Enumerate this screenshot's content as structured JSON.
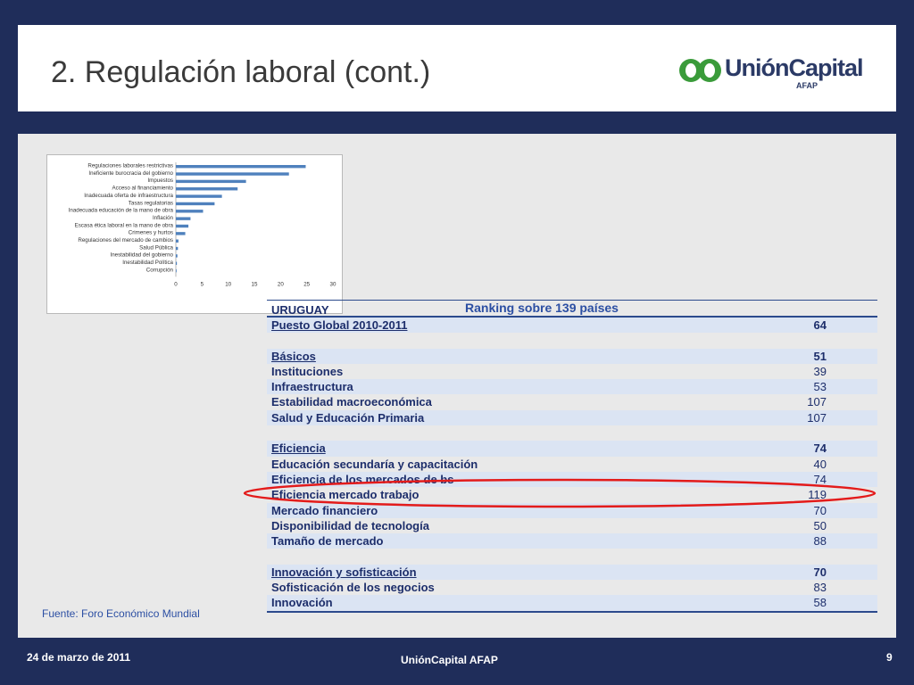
{
  "header": {
    "title": "2. Regulación laboral (cont.)",
    "logo_text": "UniónCapital",
    "logo_sub": "AFAP"
  },
  "chart_data": {
    "type": "bar",
    "orientation": "horizontal",
    "categories": [
      "Regulaciones laborales restrictivas",
      "Ineficiente burocracia del gobierno",
      "Impuestos",
      "Acceso al financiamiento",
      "Inadecuada oferta de infraestructura",
      "Tasas regulatorias",
      "Inadecuada educación de la mano de obra",
      "Inflación",
      "Escasa ética laboral en la mano de obra",
      "Crimenes y hurtos",
      "Regulaciones del mercado de cambios",
      "Salud Pública",
      "Inestabilidad del gobierno",
      "Inestabilidad Política",
      "Corrupción"
    ],
    "values": [
      24.8,
      21.6,
      13.4,
      11.8,
      8.8,
      7.4,
      5.2,
      2.8,
      2.4,
      1.8,
      0.5,
      0.4,
      0.3,
      0.2,
      0.1
    ],
    "xlim": [
      0,
      30
    ],
    "xticks": [
      "0",
      "5",
      "10",
      "15",
      "20",
      "25",
      "30"
    ],
    "grid": false,
    "bar_color": "#4f81bd"
  },
  "table": {
    "country": "URUGUAY",
    "heading": "Ranking sobre 139 países",
    "rows": [
      {
        "label": "Puesto Global 2010-2011",
        "value": "64",
        "type": "section",
        "alt": true
      },
      {
        "label": "",
        "value": "",
        "type": "blank",
        "alt": false
      },
      {
        "label": "Básicos",
        "value": "51",
        "type": "section",
        "alt": true
      },
      {
        "label": "Instituciones",
        "value": "39",
        "type": "item",
        "alt": false
      },
      {
        "label": "Infraestructura",
        "value": "53",
        "type": "item",
        "alt": true
      },
      {
        "label": "Estabilidad macroeconómica",
        "value": "107",
        "type": "item",
        "alt": false
      },
      {
        "label": "Salud y Educación Primaria",
        "value": "107",
        "type": "item",
        "alt": true
      },
      {
        "label": "",
        "value": "",
        "type": "blank",
        "alt": false
      },
      {
        "label": "Eficiencia",
        "value": "74",
        "type": "section",
        "alt": true
      },
      {
        "label": "Educación secundaría y capacitación",
        "value": "40",
        "type": "item",
        "alt": false
      },
      {
        "label": "Eficiencia de los mercados de bs",
        "value": "74",
        "type": "item",
        "alt": true
      },
      {
        "label": "Eficiencia mercado trabajo",
        "value": "119",
        "type": "item",
        "alt": false
      },
      {
        "label": "Mercado financiero",
        "value": "70",
        "type": "item",
        "alt": true
      },
      {
        "label": "Disponibilidad de tecnología",
        "value": "50",
        "type": "item",
        "alt": false
      },
      {
        "label": "Tamaño de mercado",
        "value": "88",
        "type": "item",
        "alt": true
      },
      {
        "label": "",
        "value": "",
        "type": "blank",
        "alt": false
      },
      {
        "label": "Innovación y sofisticación",
        "value": "70",
        "type": "section",
        "alt": true
      },
      {
        "label": "Sofisticación de los negocios",
        "value": "83",
        "type": "item",
        "alt": false
      },
      {
        "label": "Innovación",
        "value": "58",
        "type": "item",
        "alt": true
      }
    ]
  },
  "source": "Fuente: Foro Económico Mundial",
  "footer": {
    "date": "24 de marzo de 2011",
    "company": "UniónCapital AFAP",
    "page": "9"
  },
  "colors": {
    "navy": "#1f2d5a",
    "highlight_ellipse": "#e31b1b",
    "row_alt": "#dbe4f3"
  }
}
